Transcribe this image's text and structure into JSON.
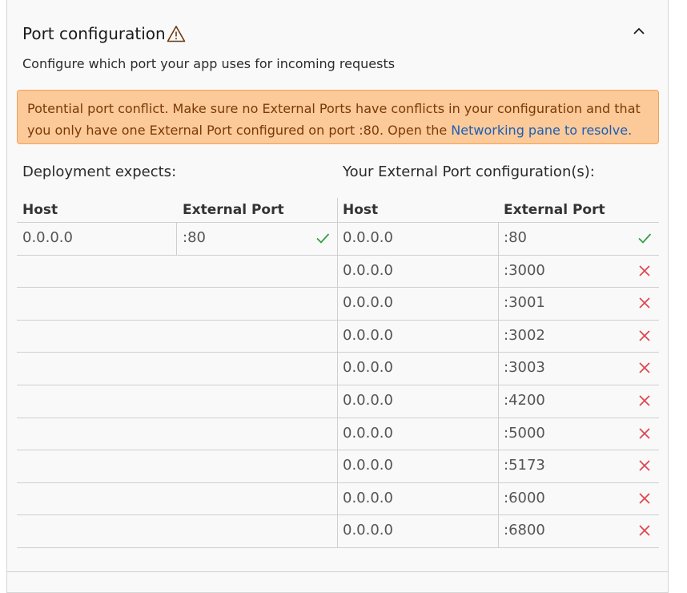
{
  "header": {
    "title": "Port configuration",
    "subtitle": "Configure which port your app uses for incoming requests",
    "warning_icon": "warning-triangle-icon",
    "collapse_icon": "chevron-up-icon"
  },
  "banner": {
    "text": "Potential port conflict. Make sure no External Ports have conflicts in your configuration and that you only have one External Port configured on port :80. Open the ",
    "link_text": "Networking pane to resolve."
  },
  "deployment": {
    "label": "Deployment expects:",
    "columns": [
      "Host",
      "External Port"
    ],
    "rows": [
      {
        "host": "0.0.0.0",
        "port": ":80",
        "status": "ok"
      }
    ]
  },
  "external": {
    "label": "Your External Port configuration(s):",
    "columns": [
      "Host",
      "External Port"
    ],
    "rows": [
      {
        "host": "0.0.0.0",
        "port": ":80",
        "status": "ok"
      },
      {
        "host": "0.0.0.0",
        "port": ":3000",
        "status": "conflict"
      },
      {
        "host": "0.0.0.0",
        "port": ":3001",
        "status": "conflict"
      },
      {
        "host": "0.0.0.0",
        "port": ":3002",
        "status": "conflict"
      },
      {
        "host": "0.0.0.0",
        "port": ":3003",
        "status": "conflict"
      },
      {
        "host": "0.0.0.0",
        "port": ":4200",
        "status": "conflict"
      },
      {
        "host": "0.0.0.0",
        "port": ":5000",
        "status": "conflict"
      },
      {
        "host": "0.0.0.0",
        "port": ":5173",
        "status": "conflict"
      },
      {
        "host": "0.0.0.0",
        "port": ":6000",
        "status": "conflict"
      },
      {
        "host": "0.0.0.0",
        "port": ":6800",
        "status": "conflict"
      }
    ]
  },
  "colors": {
    "ok": "#2e9e3e",
    "conflict": "#e0454b",
    "banner_bg": "#fcc999",
    "link": "#1b5fb5"
  }
}
